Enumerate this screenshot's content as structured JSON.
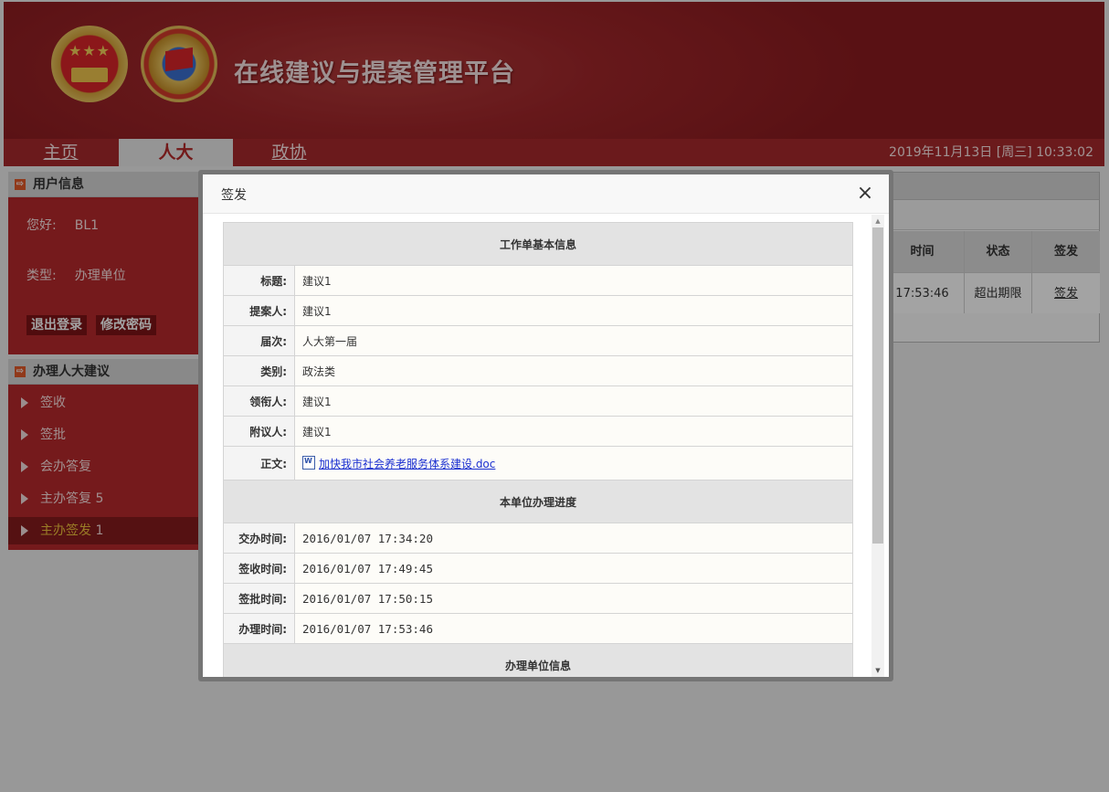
{
  "app": {
    "site_title": "在线建议与提案管理平台",
    "datetime": "2019年11月13日 [周三] 10:33:02"
  },
  "nav": {
    "tabs": [
      {
        "label": "主页"
      },
      {
        "label": "人大"
      },
      {
        "label": "政协"
      }
    ],
    "active": "人大"
  },
  "sidebar": {
    "user_header": "用户信息",
    "greeting_label": "您好:",
    "greeting_value": "BL1",
    "type_label": "类型:",
    "type_value": "办理单位",
    "logout_label": "退出登录",
    "change_password_label": "修改密码",
    "menu_header": "办理人大建议",
    "menu_items": [
      {
        "label": "签收",
        "count": ""
      },
      {
        "label": "签批",
        "count": ""
      },
      {
        "label": "会办答复",
        "count": ""
      },
      {
        "label": "主办答复",
        "count": "5"
      },
      {
        "label": "主办签发",
        "count": "1"
      }
    ]
  },
  "background_table": {
    "headers": [
      "时间",
      "状态",
      "签发"
    ],
    "row": {
      "time": "17:53:46",
      "status": "超出期限",
      "action": "签发"
    }
  },
  "modal": {
    "title": "签发",
    "close_glyph": "×",
    "section_basic": "工作单基本信息",
    "fields": [
      {
        "label": "标题:",
        "value": "建议1"
      },
      {
        "label": "提案人:",
        "value": "建议1"
      },
      {
        "label": "届次:",
        "value": "人大第一届"
      },
      {
        "label": "类别:",
        "value": "政法类"
      },
      {
        "label": "领衔人:",
        "value": "建议1"
      },
      {
        "label": "附议人:",
        "value": "建议1"
      }
    ],
    "body_label": "正文:",
    "body_file": "加快我市社会养老服务体系建设.doc",
    "section_progress": "本单位办理进度",
    "progress": [
      {
        "label": "交办时间:",
        "value": "2016/01/07 17:34:20"
      },
      {
        "label": "签收时间:",
        "value": "2016/01/07 17:49:45"
      },
      {
        "label": "签批时间:",
        "value": "2016/01/07 17:50:15"
      },
      {
        "label": "办理时间:",
        "value": "2016/01/07 17:53:46"
      }
    ],
    "section_unit": "办理单位信息"
  },
  "icons": {
    "scroll_up": "▲",
    "scroll_down": "▼",
    "arrow_box": "⇨"
  },
  "colors": {
    "brand_red": "#a82a2c",
    "menu_active_text": "#f0c23c",
    "link_blue": "#1a2fd0"
  }
}
